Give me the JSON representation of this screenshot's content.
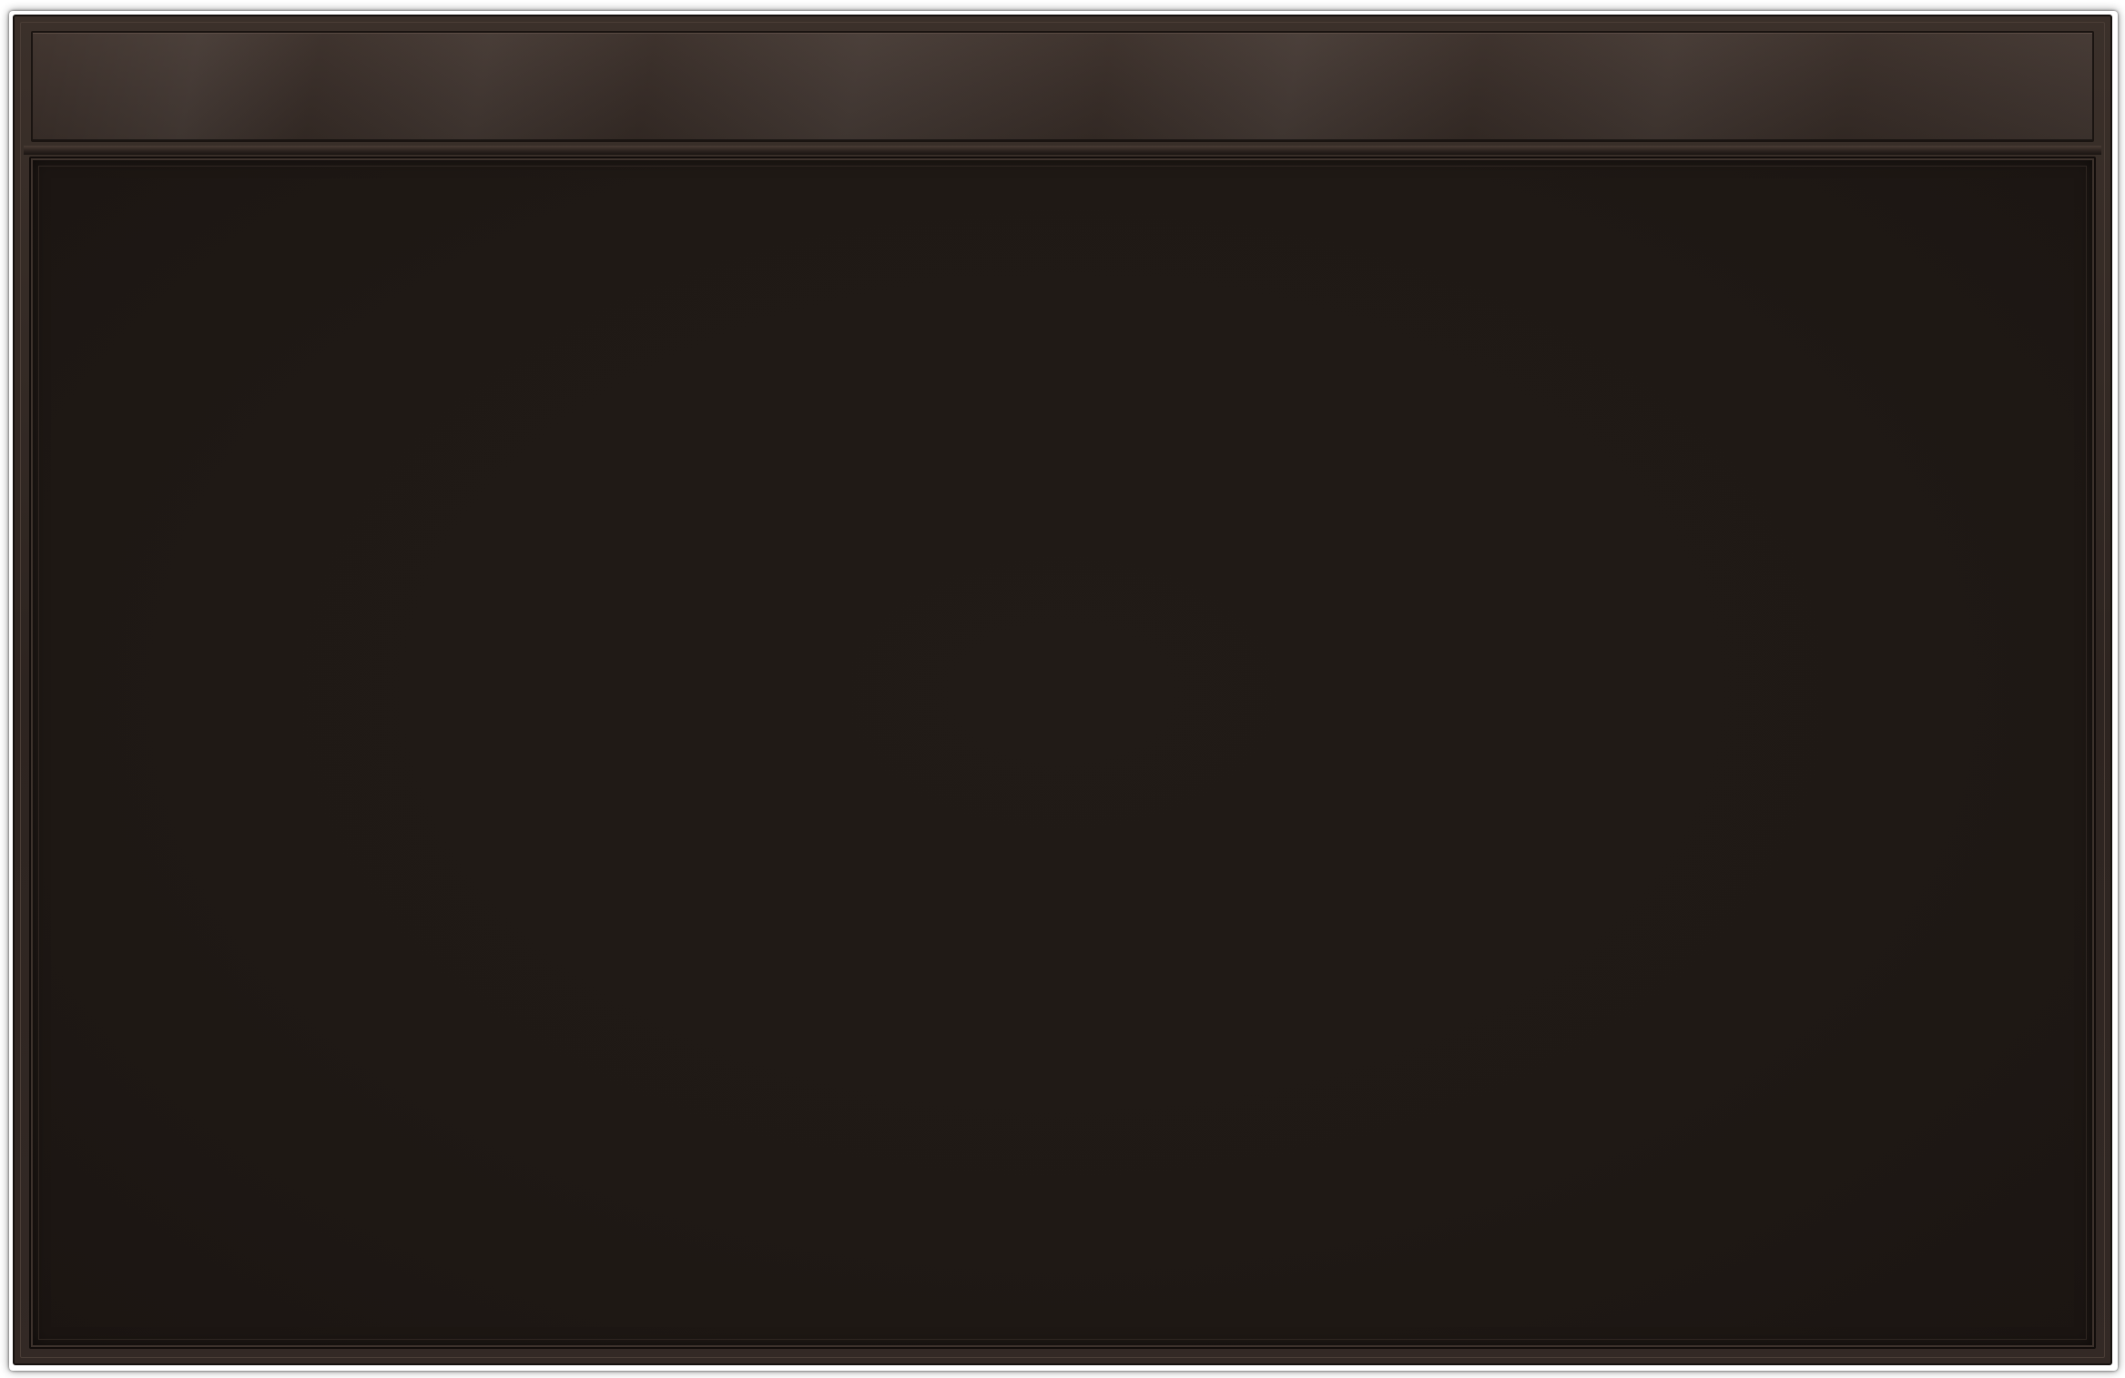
{
  "panel": {
    "title": "",
    "colors": {
      "frame": "#2d2420",
      "title_bar": "#3a2f2a",
      "content": "#1f1915",
      "border_dark": "#16110e"
    }
  }
}
